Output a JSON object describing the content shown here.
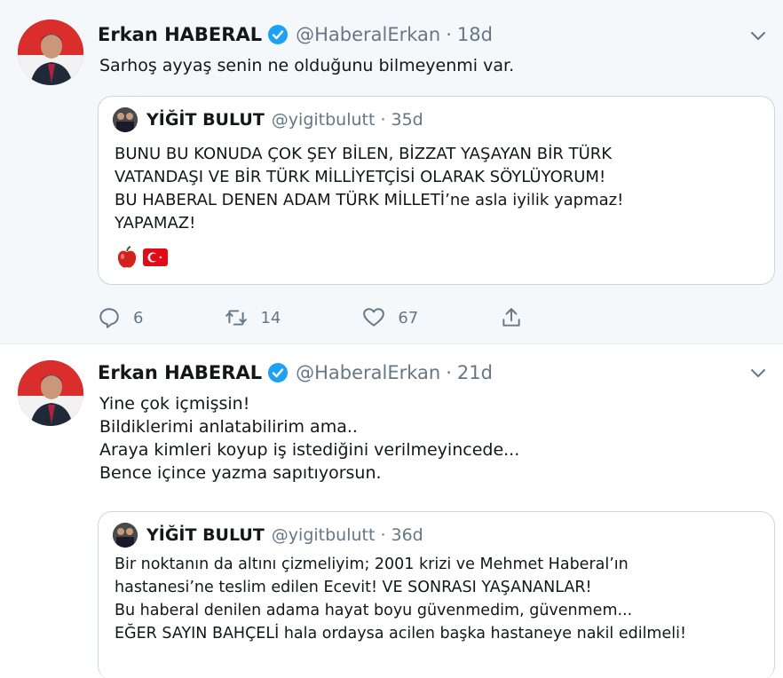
{
  "tweets": [
    {
      "author": {
        "name": "Erkan HABERAL",
        "handle": "@HaberalErkan",
        "time": "18d"
      },
      "text": [
        "Sarhoş ayyaş senin ne olduğunu bilmeyenmi var."
      ],
      "quote": {
        "author": {
          "name": "YİĞİT BULUT",
          "handle": "@yigitbulutt",
          "time": "35d"
        },
        "lines": [
          "BUNU BU KONUDA ÇOK ŞEY BİLEN, BİZZAT YAŞAYAN BİR TÜRK",
          "VATANDAŞI VE BİR TÜRK MİLLİYETÇİSİ OLARAK SÖYLÜYORUM!",
          "BU HABERAL DENEN ADAM TÜRK MİLLETİ’ne asla iyilik yapmaz!",
          "YAPAMAZ!"
        ],
        "emojis": [
          "apple-icon",
          "turkey-flag-icon"
        ]
      },
      "actions": {
        "replies": "6",
        "retweets": "14",
        "likes": "67"
      }
    },
    {
      "author": {
        "name": "Erkan HABERAL",
        "handle": "@HaberalErkan",
        "time": "21d"
      },
      "text": [
        "Yine çok içmişsin!",
        "Bildiklerimi anlatabilirim ama..",
        "Araya kimleri koyup iş istediğini verilmeyincede...",
        "Bence içince yazma sapıtıyorsun."
      ],
      "quote": {
        "author": {
          "name": "YİĞİT BULUT",
          "handle": "@yigitbulutt",
          "time": "36d"
        },
        "lines": [
          "Bir noktanın da altını çizmeliyim; 2001 krizi ve Mehmet Haberal’ın",
          "hastanesi’ne teslim edilen Ecevit! VE SONRASI YAŞANANLAR!",
          "Bu haberal denilen adama hayat boyu güvenmedim, güvenmem...",
          "EĞER SAYIN BAHÇELİ hala ordaysa acilen başka hastaneye nakil edilmeli!"
        ]
      }
    }
  ],
  "separator": "·",
  "colors": {
    "secondary": "#657786",
    "verified": "#1da1f2",
    "border": "#ccd6dd",
    "highlight_bg": "#f5f8fa"
  }
}
